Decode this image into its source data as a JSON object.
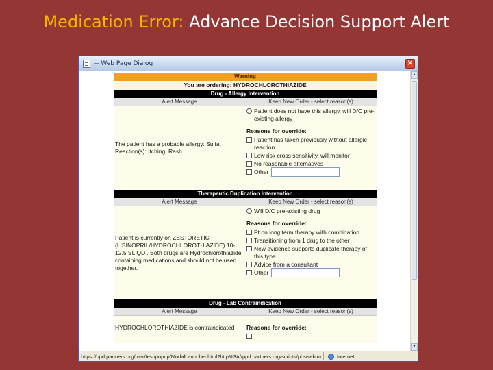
{
  "slide": {
    "title_highlight": "Medication Error:",
    "title_rest": "Advance Decision Support Alert"
  },
  "dialog": {
    "title": "-- Web Page Dialog",
    "close_glyph": "✕",
    "status_url": "https://ppd.partners.org/mar/test/popup/ModalLauncher.html?http%3A//ppd.partners.org/scripts/phsweb.m",
    "status_zone": "Internet"
  },
  "alert": {
    "warning": "Warning",
    "ordering_prefix": "You are ordering:",
    "ordering_drug": "HYDROCHLOROTHIAZIDE",
    "col_alert": "Alert Message",
    "col_keep": "Keep New Order - select reason(s)",
    "reasons_label": "Reasons for override:",
    "other_label": "Other",
    "sections": {
      "allergy": {
        "title": "Drug - Allergy Intervention",
        "message": "The patient has a probable allergy: Sulfa. Reaction(s): Itching, Rash.",
        "radio": "Patient does not have this allergy, will D/C pre-existing allergy",
        "reasons": [
          "Patient has taken previously without allergic reaction",
          "Low risk cross sensitivity, will monitor",
          "No reasonable alternatives"
        ]
      },
      "duplication": {
        "title": "Therapeutic Duplication Intervention",
        "message": "Patient is currently on ZESTORETIC (LISINOPRIL/HYDROCHLOROTHIAZIDE) 10-12.5 SL QD . Both drugs are Hydrochlorothiazide containing medications and should not be used together.",
        "radio": "Will D/C pre-existing drug",
        "reasons": [
          "Pt on long term therapy with combination",
          "Transitioning from 1 drug to the other",
          "New evidence supports duplicate therapy of this type",
          "Advice from a consultant"
        ]
      },
      "lab": {
        "title": "Drug - Lab Contraindication",
        "message": "HYDROCHLOROTHIAZIDE is contraindicated"
      }
    }
  }
}
